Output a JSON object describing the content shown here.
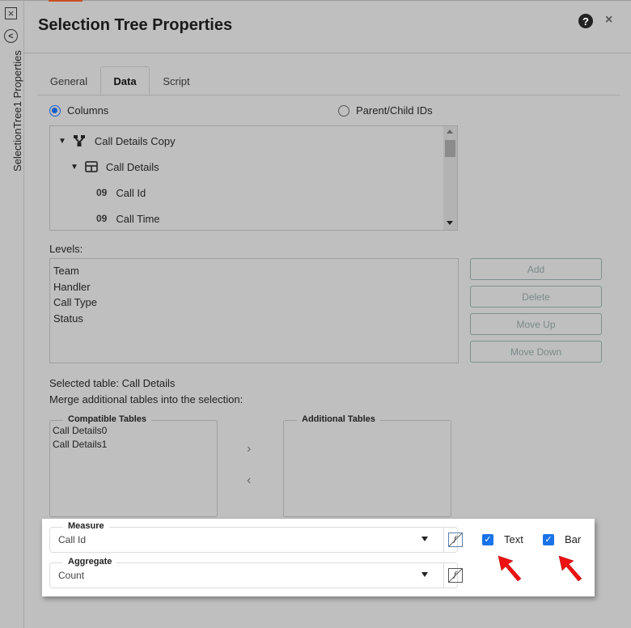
{
  "window": {
    "title": "Selection Tree Properties",
    "rail_label": "SelectionTree1 Properties",
    "help_icon": "?",
    "close_icon": "×"
  },
  "tabs": [
    {
      "label": "General",
      "active": false
    },
    {
      "label": "Data",
      "active": true
    },
    {
      "label": "Script",
      "active": false
    }
  ],
  "source_mode": {
    "options": [
      {
        "label": "Columns",
        "selected": true
      },
      {
        "label": "Parent/Child IDs",
        "selected": false
      }
    ]
  },
  "tree": {
    "items": [
      {
        "label": "Call Details Copy",
        "icon": "merge-icon",
        "expanded": true
      },
      {
        "label": "Call Details",
        "icon": "table-icon",
        "expanded": true
      },
      {
        "label": "Call Id",
        "icon": "09"
      },
      {
        "label": "Call Time",
        "icon": "09"
      }
    ]
  },
  "levels": {
    "label": "Levels:",
    "items": [
      "Team",
      "Handler",
      "Call Type",
      "Status"
    ]
  },
  "level_buttons": [
    "Add",
    "Delete",
    "Move Up",
    "Move Down"
  ],
  "merge": {
    "selected_table": "Selected table: Call Details",
    "instruction": "Merge additional tables into the selection:",
    "compatible_title": "Compatible Tables",
    "compatible_items": [
      "Call Details0",
      "Call Details1"
    ],
    "additional_title": "Additional Tables",
    "additional_items": [],
    "move_right": "›",
    "move_left": "‹"
  },
  "measure": {
    "label": "Measure",
    "value": "Call Id"
  },
  "aggregate": {
    "label": "Aggregate",
    "value": "Count"
  },
  "options": {
    "text": {
      "label": "Text",
      "checked": true
    },
    "bar": {
      "label": "Bar",
      "checked": true
    }
  },
  "fx_label": "f",
  "check_mark": "✓",
  "colors": {
    "accent": "#1a73e8",
    "radio": "#1a5fd0",
    "annotation_arrow": "#ee1111",
    "top_tab": "#c8501e"
  }
}
